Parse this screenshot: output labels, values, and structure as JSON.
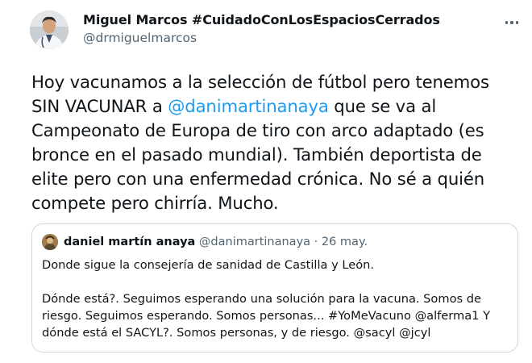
{
  "tweet": {
    "author_name": "Miguel Marcos #CuidadoConLosEspaciosCerrados",
    "author_handle": "@drmiguelmarcos",
    "more_icon": "more-dots-icon",
    "text_part1": "Hoy vacunamos a la selección de fútbol pero tenemos SIN VACUNAR a ",
    "mention": "@danimartinanaya",
    "text_part2": " que se va al Campeonato de Europa de tiro con arco adaptado (es bronce en el pasado mundial). También deportista de elite pero con una enfermedad crónica. No sé a quién compete pero chirría. Mucho."
  },
  "quote": {
    "author_name": "daniel martín anaya",
    "author_handle": "@danimartinanaya",
    "separator": " · ",
    "date": "26 may.",
    "line1": "Donde sigue la consejería de sanidad de Castilla y León.",
    "para2": "Dónde está?. Seguimos esperando una solución para la vacuna. Somos de riesgo. Seguimos esperando. Somos personas... #YoMeVacuno  @alferma1  Y dónde está el SACYL?. Somos personas, y de riesgo. @sacyl  @jcyl"
  },
  "colors": {
    "link": "#1d9bf0",
    "secondary_text": "#536471",
    "border": "#cfd9de"
  }
}
